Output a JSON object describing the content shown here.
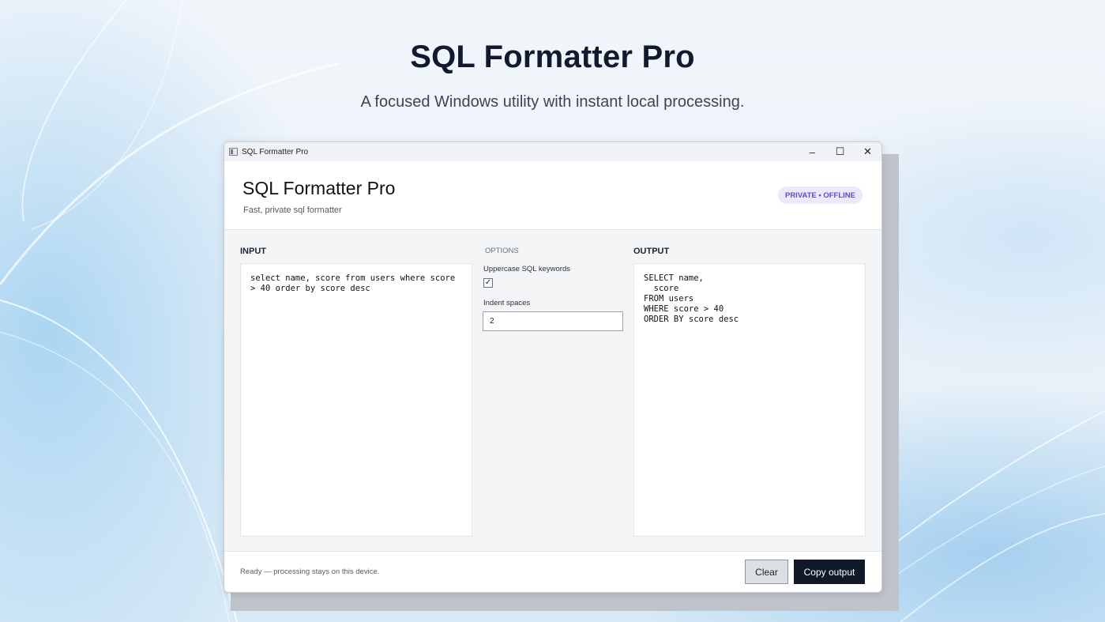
{
  "hero": {
    "title": "SQL Formatter Pro",
    "subtitle": "A focused Windows utility with instant local processing."
  },
  "window": {
    "titlebar_title": "SQL Formatter Pro",
    "app_icon": "app-window-icon",
    "controls": {
      "minimize": "–",
      "maximize": "☐",
      "close": "✕"
    }
  },
  "header": {
    "title": "SQL Formatter Pro",
    "subtitle": "Fast, private sql formatter",
    "badge": "PRIVATE • OFFLINE"
  },
  "input": {
    "label": "INPUT",
    "value": "select name, score from users where score > 40 order by score desc"
  },
  "options": {
    "label": "OPTIONS",
    "uppercase_label": "Uppercase SQL keywords",
    "uppercase_checked": true,
    "checkmark": "✓",
    "indent_label": "Indent spaces",
    "indent_value": "2"
  },
  "output": {
    "label": "OUTPUT",
    "value": "SELECT name,\n  score\nFROM users\nWHERE score > 40\nORDER BY score desc"
  },
  "footer": {
    "status": "Ready — processing stays on this device.",
    "clear_label": "Clear",
    "copy_label": "Copy output"
  },
  "colors": {
    "accent_dark": "#111827",
    "badge_bg": "#ece9fb",
    "badge_text": "#5b4fc4"
  }
}
